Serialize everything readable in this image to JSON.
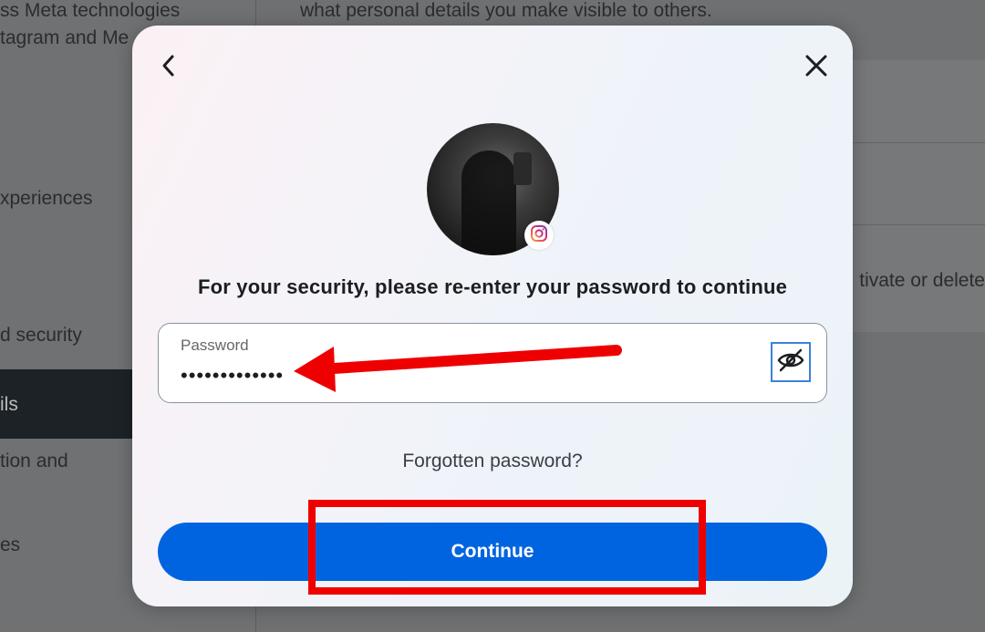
{
  "background": {
    "sidebar_lines": [
      "ss Meta technologies",
      "tagram and Me",
      "xperiences",
      "d security",
      "ils",
      "tion and",
      "es"
    ],
    "main_top_text": "what personal details you make visible to others.",
    "main_row_text": "tivate or delete"
  },
  "modal": {
    "heading": "For your security, please re-enter your password to continue",
    "password_label": "Password",
    "password_value": "•••••••••••••",
    "forgot_label": "Forgotten password?",
    "continue_label": "Continue"
  },
  "icons": {
    "back": "chevron-left-icon",
    "close": "close-icon",
    "eye": "eye-off-icon",
    "instagram": "instagram-icon"
  },
  "colors": {
    "primary_button": "#0064e0",
    "annotation_red": "#ef0000",
    "eye_focus_border": "#3b82d6"
  }
}
